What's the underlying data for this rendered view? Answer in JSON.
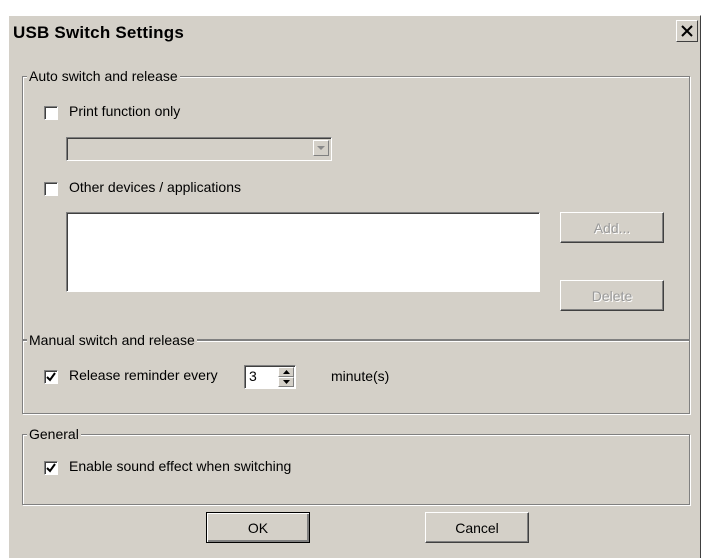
{
  "window": {
    "title": "USB Switch Settings"
  },
  "auto": {
    "legend": "Auto switch and release",
    "print_only": {
      "label": "Print function only",
      "checked": false
    },
    "printer_select": {
      "value": ""
    },
    "other_devices": {
      "label": "Other devices / applications",
      "checked": false
    },
    "list_items": [],
    "add_label": "Add...",
    "delete_label": "Delete"
  },
  "manual": {
    "legend": "Manual switch and release",
    "reminder": {
      "label": "Release reminder every",
      "checked": true,
      "value": "3",
      "unit": "minute(s)"
    }
  },
  "general": {
    "legend": "General",
    "sound": {
      "label": "Enable sound effect when switching",
      "checked": true
    }
  },
  "buttons": {
    "ok": "OK",
    "cancel": "Cancel"
  },
  "icons": {
    "close": "close-icon",
    "dropdown": "chevron-down-icon",
    "check": "checkmark-icon",
    "spin": "spin-arrows-icon"
  }
}
